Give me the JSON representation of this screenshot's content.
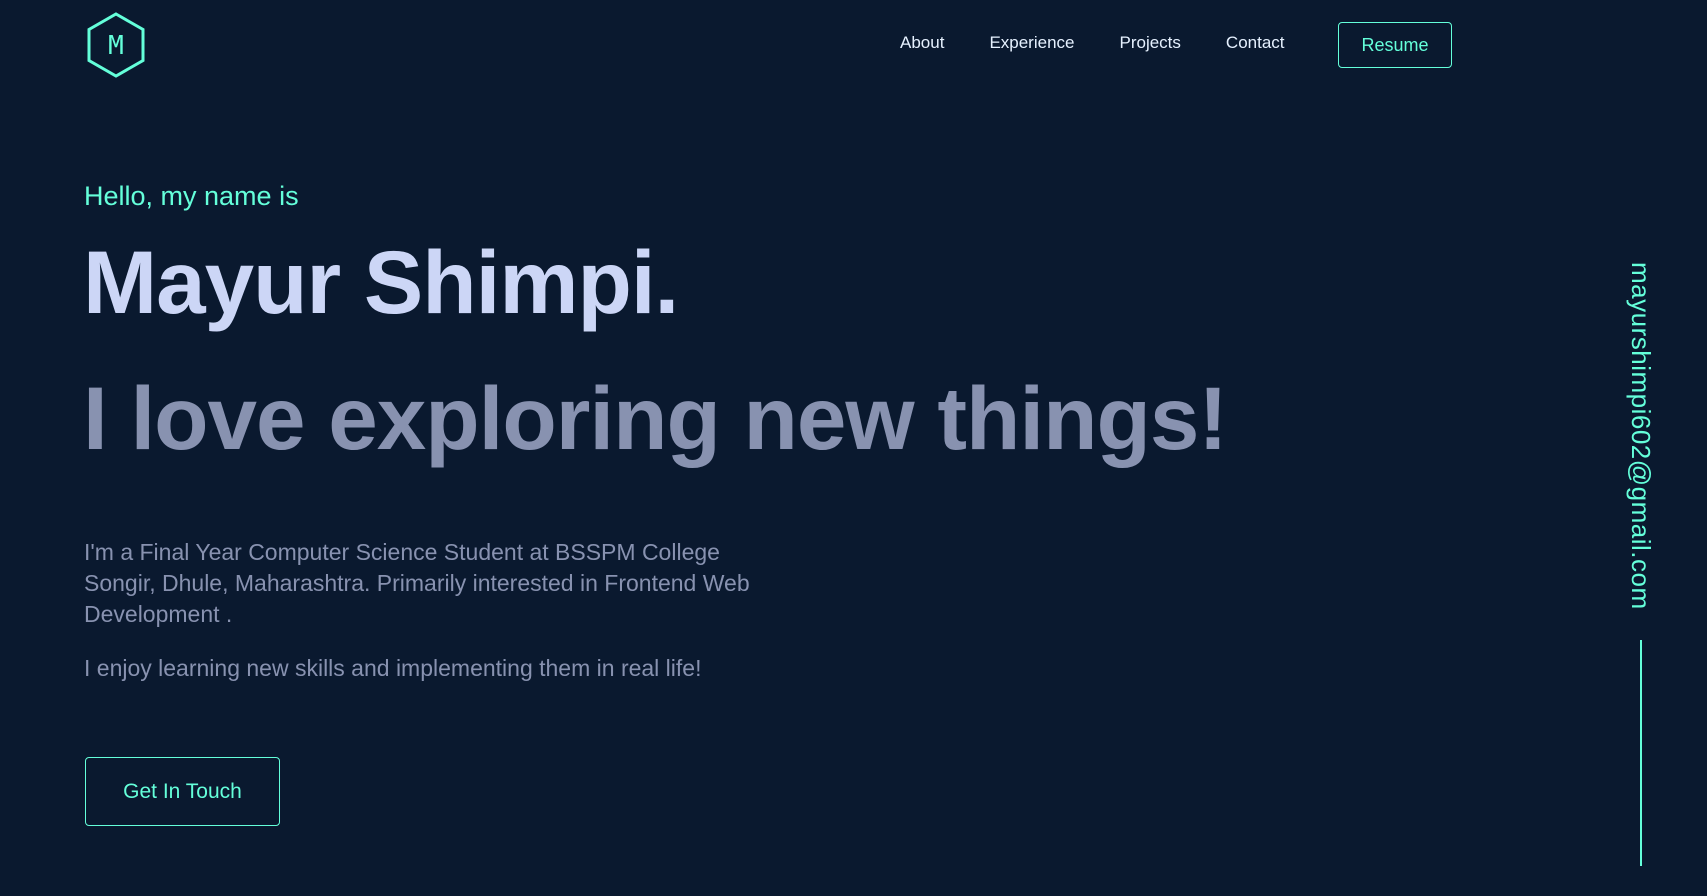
{
  "header": {
    "logo_letter": "M",
    "nav": [
      {
        "label": "About"
      },
      {
        "label": "Experience"
      },
      {
        "label": "Projects"
      },
      {
        "label": "Contact"
      }
    ],
    "resume_label": "Resume"
  },
  "hero": {
    "greeting": "Hello, my name is",
    "name": "Mayur Shimpi.",
    "tagline": "I love exploring new things!",
    "bio": "I'm a Final Year Computer Science Student at BSSPM College Songir, Dhule, Maharashtra. Primarily interested in Frontend Web Development .",
    "bio2": "I enjoy learning new skills and implementing them in real life!",
    "cta_label": "Get In Touch"
  },
  "side": {
    "email": "mayurshimpi602@gmail.com"
  },
  "theme": {
    "background": "#0a192f",
    "accent": "#64ffda",
    "heading": "#ccd6f6",
    "muted": "#8892b0",
    "nav_text": "#e6f1ff"
  }
}
